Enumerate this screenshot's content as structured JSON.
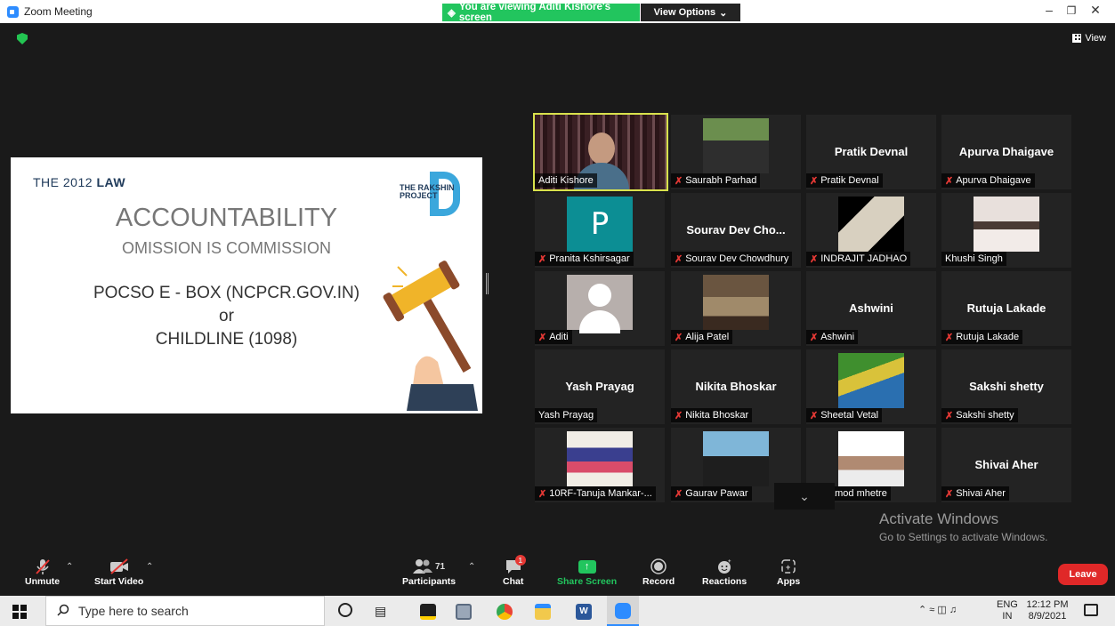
{
  "window": {
    "title": "Zoom Meeting"
  },
  "banner": {
    "viewing": "You are viewing Aditi Kishore's screen",
    "view_options": "View Options"
  },
  "top_right": {
    "view_label": "View"
  },
  "slide": {
    "law_prefix": "THE 2012 ",
    "law_bold": "LAW",
    "logo_text": "THE RAKSHIN PROJECT",
    "heading": "ACCOUNTABILITY",
    "subheading": "OMISSION IS COMMISSION",
    "line1": "POCSO E - BOX (NCPCR.GOV.IN)",
    "line2": "or",
    "line3": "CHILDLINE (1098)"
  },
  "participants": [
    {
      "label": "Aditi Kishore",
      "big": "",
      "muted": false,
      "kind": "video-curtain",
      "active": true
    },
    {
      "label": "Saurabh Parhad",
      "big": "",
      "muted": true,
      "kind": "photo-man"
    },
    {
      "label": "Pratik Devnal",
      "big": "Pratik Devnal",
      "muted": true,
      "kind": "none"
    },
    {
      "label": "Apurva Dhaigave",
      "big": "Apurva Dhaigave",
      "muted": true,
      "kind": "none"
    },
    {
      "label": "Pranita Kshirsagar",
      "big": "",
      "muted": true,
      "kind": "letter",
      "letter": "P"
    },
    {
      "label": "Sourav Dev Chowdhury",
      "big": "Sourav  Dev  Cho...",
      "muted": true,
      "kind": "none"
    },
    {
      "label": "INDRAJIT JADHAO",
      "big": "",
      "muted": true,
      "kind": "photo-bike"
    },
    {
      "label": "Khushi Singh",
      "big": "",
      "muted": false,
      "kind": "photo-girl"
    },
    {
      "label": "Aditi",
      "big": "",
      "muted": true,
      "kind": "default-avatar"
    },
    {
      "label": "Alija Patel",
      "big": "",
      "muted": true,
      "kind": "photo-room"
    },
    {
      "label": "Ashwini",
      "big": "Ashwini",
      "muted": true,
      "kind": "none"
    },
    {
      "label": "Rutuja Lakade",
      "big": "Rutuja Lakade",
      "muted": true,
      "kind": "none"
    },
    {
      "label": "Yash Prayag",
      "big": "Yash Prayag",
      "muted": false,
      "kind": "none"
    },
    {
      "label": "Nikita Bhoskar",
      "big": "Nikita Bhoskar",
      "muted": true,
      "kind": "none"
    },
    {
      "label": "Sheetal Vetal",
      "big": "",
      "muted": true,
      "kind": "photo-art"
    },
    {
      "label": "Sakshi  shetty",
      "big": "Sakshi  shetty",
      "muted": true,
      "kind": "none"
    },
    {
      "label": "10RF-Tanuja Mankar-...",
      "big": "",
      "muted": true,
      "kind": "photo-paint"
    },
    {
      "label": "Gaurav Pawar",
      "big": "",
      "muted": true,
      "kind": "photo-moto"
    },
    {
      "label": "pramod mhetre",
      "big": "",
      "muted": true,
      "kind": "photo-boy"
    },
    {
      "label": "Shivai Aher",
      "big": "Shivai Aher",
      "muted": true,
      "kind": "none"
    }
  ],
  "watermark": {
    "title": "Activate Windows",
    "subtitle": "Go to Settings to activate Windows."
  },
  "toolbar": {
    "unmute": "Unmute",
    "start_video": "Start Video",
    "participants": "Participants",
    "participants_count": "71",
    "chat": "Chat",
    "chat_badge": "1",
    "share_screen": "Share Screen",
    "record": "Record",
    "reactions": "Reactions",
    "apps": "Apps",
    "leave": "Leave"
  },
  "taskbar": {
    "search_placeholder": "Type here to search",
    "lang_line1": "ENG",
    "lang_line2": "IN",
    "time": "12:12 PM",
    "date": "8/9/2021"
  },
  "colors": {
    "share_green": "#22c55e",
    "leave_red": "#e02828",
    "active_border": "#d9e24c",
    "muted_red": "#e53935"
  }
}
